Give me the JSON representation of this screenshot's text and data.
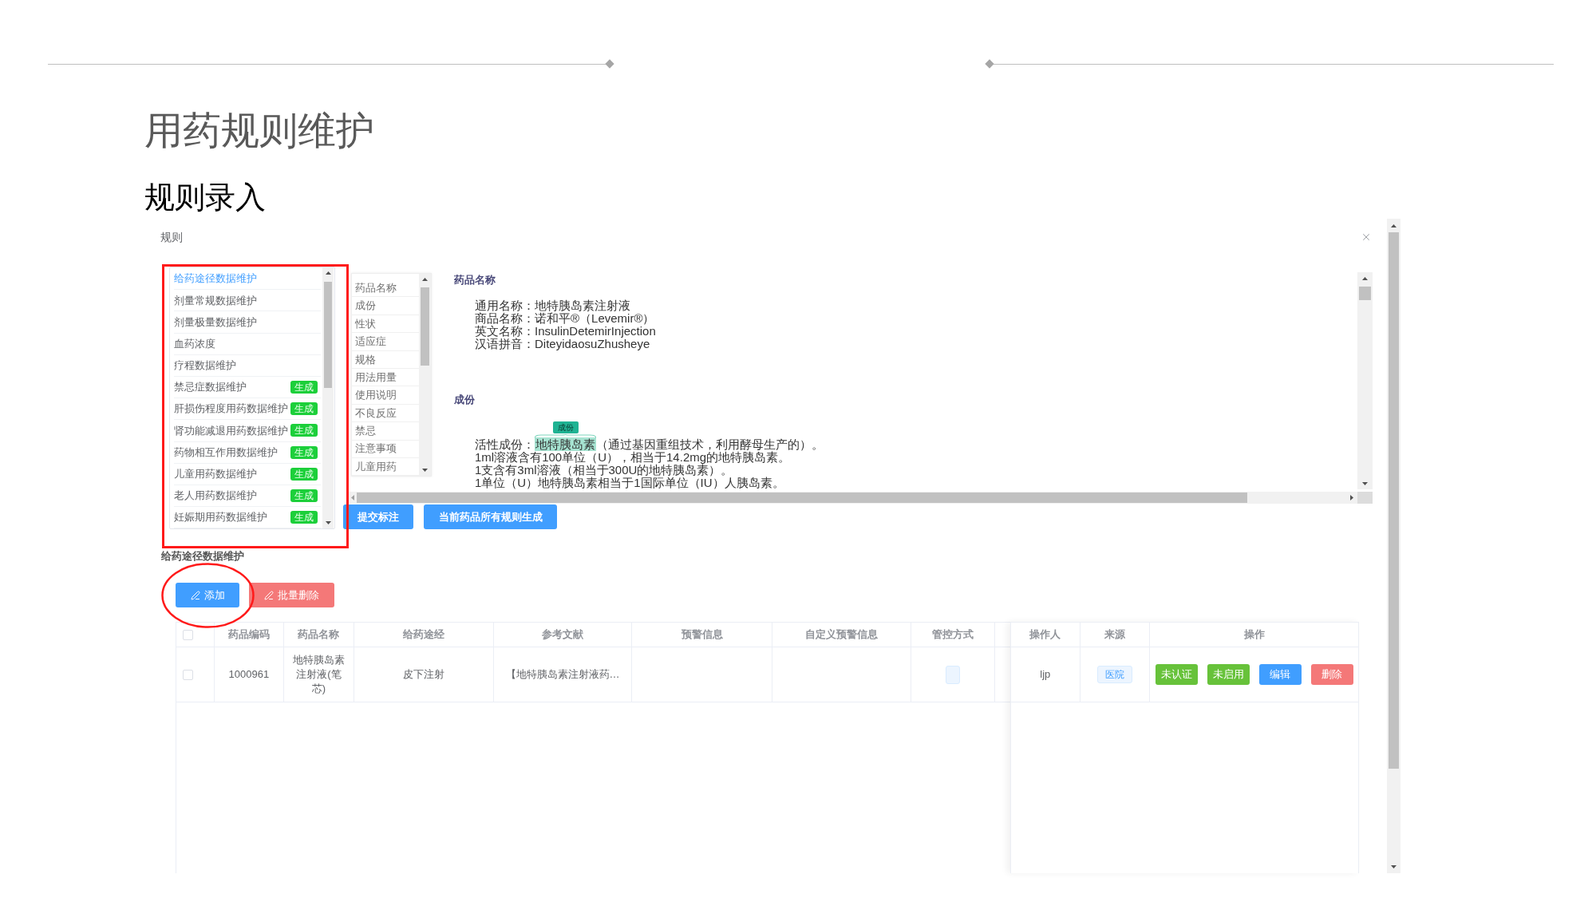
{
  "slide": {
    "title": "用药规则维护",
    "subtitle": "规则录入"
  },
  "dialog": {
    "title": "规则",
    "rule_list": [
      {
        "label": "给药途径数据维护",
        "selected": true
      },
      {
        "label": "剂量常规数据维护",
        "selected": false
      },
      {
        "label": "剂量极量数据维护",
        "selected": false
      },
      {
        "label": "血药浓度",
        "selected": false
      },
      {
        "label": "疗程数据维护",
        "selected": false
      },
      {
        "label": "禁忌症数据维护",
        "selected": false,
        "badge": "生成"
      },
      {
        "label": "肝损伤程度用药数据维护",
        "selected": false,
        "badge": "生成"
      },
      {
        "label": "肾功能减退用药数据维护",
        "selected": false,
        "badge": "生成"
      },
      {
        "label": "药物相互作用数据维护",
        "selected": false,
        "badge": "生成"
      },
      {
        "label": "儿童用药数据维护",
        "selected": false,
        "badge": "生成"
      },
      {
        "label": "老人用药数据维护",
        "selected": false,
        "badge": "生成"
      },
      {
        "label": "妊娠期用药数据维护",
        "selected": false,
        "badge": "生成"
      }
    ],
    "section_nav": [
      "药品名称",
      "成份",
      "性状",
      "适应症",
      "规格",
      "用法用量",
      "使用说明",
      "不良反应",
      "禁忌",
      "注意事项",
      "儿童用药"
    ],
    "document": [
      {
        "heading": "药品名称",
        "lines": [
          {
            "kind": "plain",
            "text": "通用名称：地特胰岛素注射液"
          },
          {
            "kind": "plain",
            "text": "商品名称：诺和平®（Levemir®）"
          },
          {
            "kind": "plain",
            "text": "英文名称：InsulinDetemirInjection"
          },
          {
            "kind": "plain",
            "text": "汉语拼音：DiteyidaosuZhusheye"
          }
        ]
      },
      {
        "heading": "成份",
        "lines": [
          {
            "kind": "annotated",
            "before": "活性成份：",
            "highlight": "地特胰岛素",
            "tag": "成份",
            "after": "（通过基因重组技术，利用酵母生产的）。"
          },
          {
            "kind": "plain",
            "text": "1ml溶液含有100单位（U），相当于14.2mg的地特胰岛素。"
          },
          {
            "kind": "plain",
            "text": "1支含有3ml溶液（相当于300U的地特胰岛素）。"
          },
          {
            "kind": "plain",
            "text": "1单位（U）地特胰岛素相当于1国际单位（IU）人胰岛素。"
          }
        ]
      }
    ],
    "action_buttons": [
      "提交标注",
      "当前药品所有规则生成"
    ],
    "table_title": "给药途径数据维护",
    "toolbar": [
      {
        "label": "添加",
        "kind": "primary"
      },
      {
        "label": "批量删除",
        "kind": "danger"
      }
    ],
    "table": {
      "select_all_checked": false,
      "columns": [
        "药品编码",
        "药品名称",
        "给药途经",
        "参考文献",
        "预警信息",
        "自定义预警信息",
        "管控方式"
      ],
      "fixed_columns": [
        "操作人",
        "来源",
        "操作"
      ],
      "rows": [
        {
          "checked": false,
          "code": "1000961",
          "name": "地特胰岛素注射液(笔芯)",
          "route": "皮下注射",
          "reference": "【地特胰岛素注射液药…",
          "operator": "ljp",
          "source": "医院",
          "actions": [
            {
              "label": "未认证",
              "kind": "success"
            },
            {
              "label": "未启用",
              "kind": "success"
            },
            {
              "label": "编辑",
              "kind": "primary"
            },
            {
              "label": "删除",
              "kind": "danger"
            }
          ]
        }
      ]
    }
  }
}
